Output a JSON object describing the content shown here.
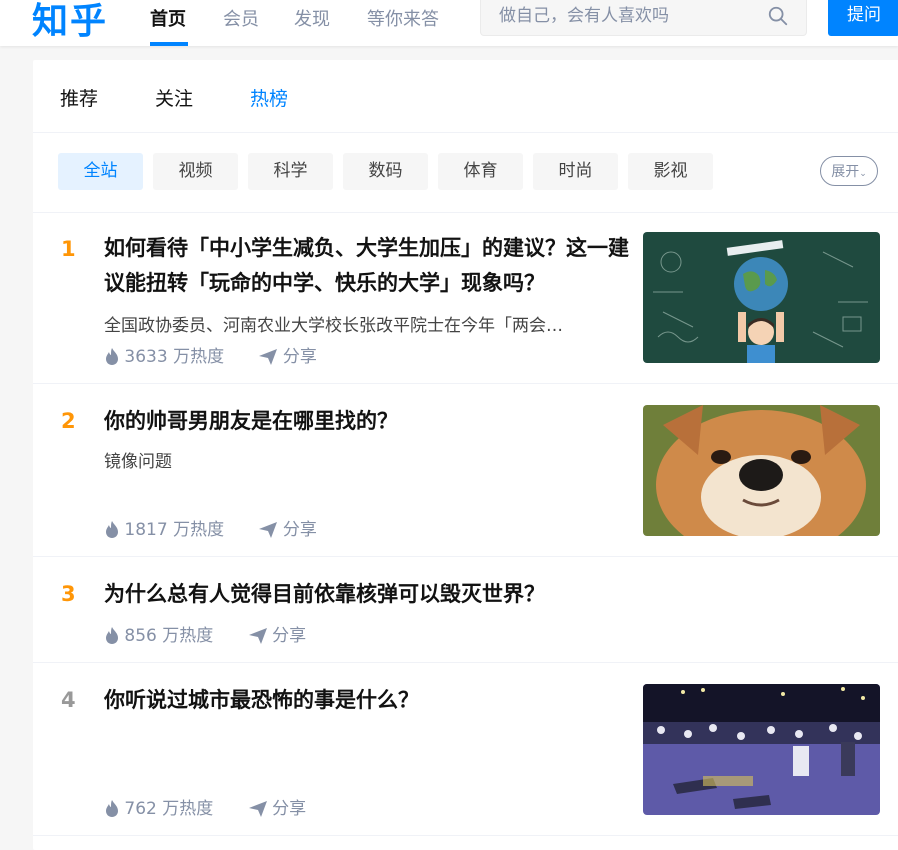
{
  "header": {
    "logo": "知乎",
    "nav": [
      "首页",
      "会员",
      "发现",
      "等你来答"
    ],
    "search_placeholder": "做自己，会有人喜欢吗",
    "ask_label": "提问"
  },
  "tabs": [
    "推荐",
    "关注",
    "热榜"
  ],
  "categories": [
    "全站",
    "视频",
    "科学",
    "数码",
    "体育",
    "时尚",
    "影视"
  ],
  "expand_label": "展开",
  "hot_list": [
    {
      "rank": "1",
      "title": "如何看待「中小学生减负、大学生加压」的建议？这一建议能扭转「玩命的中学、快乐的大学」现象吗？",
      "excerpt": "全国政协委员、河南农业大学校长张改平院士在今年「两会…",
      "heat": "3633 万热度",
      "share": "分享"
    },
    {
      "rank": "2",
      "title": "你的帅哥男朋友是在哪里找的？",
      "excerpt": "镜像问题",
      "heat": "1817 万热度",
      "share": "分享"
    },
    {
      "rank": "3",
      "title": "为什么总有人觉得目前依靠核弹可以毁灭世界？",
      "excerpt": "",
      "heat": "856 万热度",
      "share": "分享"
    },
    {
      "rank": "4",
      "title": "你听说过城市最恐怖的事是什么？",
      "excerpt": "",
      "heat": "762 万热度",
      "share": "分享"
    }
  ],
  "colors": {
    "brand": "#0084ff",
    "rank_top": "#ff9607",
    "rank_other": "#999999",
    "meta": "#8590a6"
  }
}
